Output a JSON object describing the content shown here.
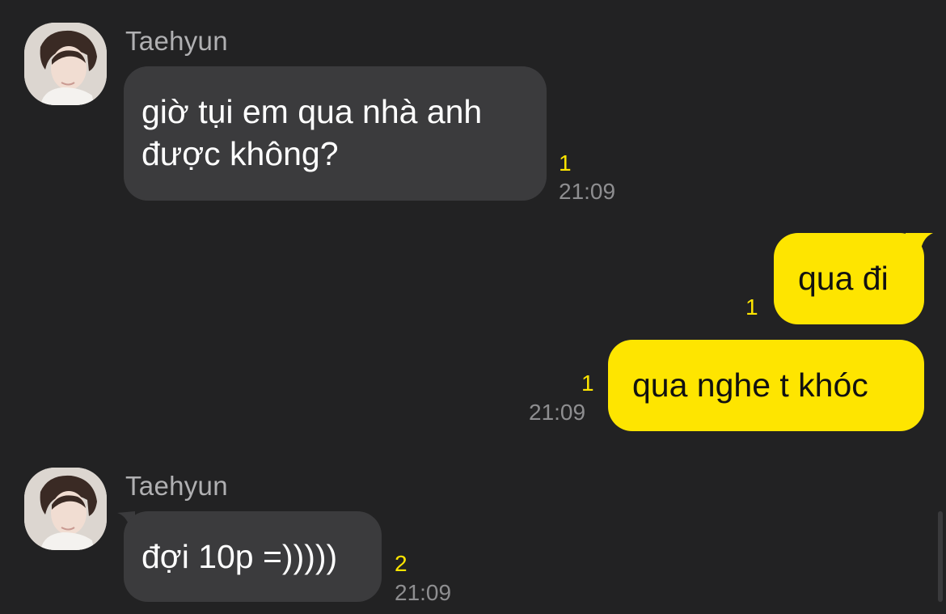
{
  "messages": [
    {
      "sender": "Taehyun",
      "text_lines": [
        "giờ tụi em qua nhà anh",
        "được không?"
      ],
      "unread": "1",
      "time": "21:09",
      "direction": "incoming"
    },
    {
      "text": "qua đi",
      "unread": "1",
      "direction": "outgoing"
    },
    {
      "text": "qua nghe t khóc",
      "unread": "1",
      "time": "21:09",
      "direction": "outgoing"
    },
    {
      "sender": "Taehyun",
      "text": "đợi 10p =)))))",
      "unread": "2",
      "time": "21:09",
      "direction": "incoming"
    }
  ],
  "theme": {
    "background": "#222223",
    "incoming_bubble": "#3b3b3d",
    "outgoing_bubble": "#fee500",
    "unread_color": "#fee500",
    "time_color": "#8e8e90",
    "sender_color": "#b0b0b2"
  }
}
